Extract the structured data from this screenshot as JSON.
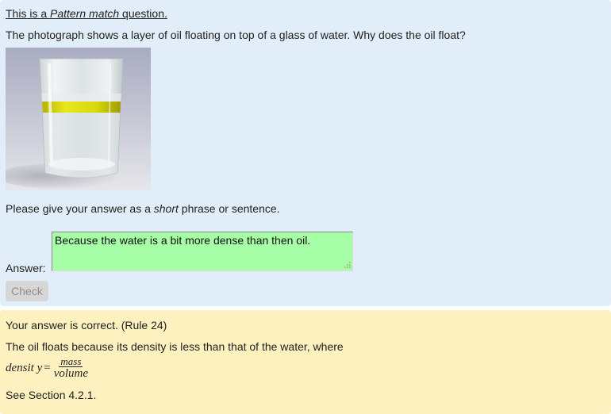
{
  "question": {
    "intro_prefix": "This is a ",
    "intro_emphasis": "Pattern match",
    "intro_suffix": " question.",
    "text": "The photograph shows a layer of oil floating on top of a glass of water. Why does the oil float?",
    "image_alt": "Glass of water with a layer of oil",
    "instruction_prefix": "Please give your answer as a ",
    "instruction_emphasis": "short",
    "instruction_suffix": " phrase or sentence.",
    "answer_label": "Answer:",
    "answer_value": "Because the water is a bit more dense than then oil.",
    "check_label": "Check"
  },
  "feedback": {
    "status": "Your answer is correct. (Rule 24)",
    "explanation": "The oil floats because its density is less than that of the water, where",
    "formula_lhs": "densit y",
    "formula_eq": "=",
    "formula_numerator": "mass",
    "formula_denominator": "volume",
    "reference": "See Section 4.2.1."
  },
  "colors": {
    "question_panel": "#e1eef9",
    "feedback_panel": "#fdf2bf",
    "answer_correct": "#a6ffa6"
  }
}
